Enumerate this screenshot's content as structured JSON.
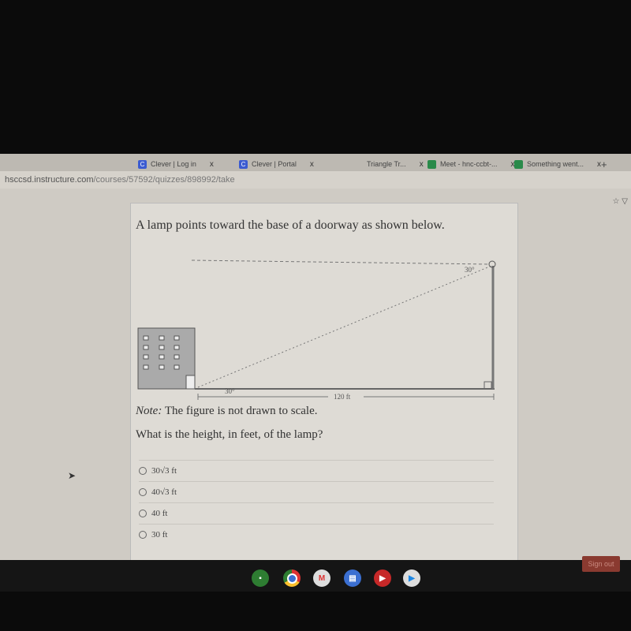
{
  "browser": {
    "tabs": [
      {
        "label": "Clever | Log in",
        "icon": "clever-icon"
      },
      {
        "label": "Clever | Portal",
        "icon": "clever-icon"
      },
      {
        "label": "Triangle Tr...",
        "icon": ""
      },
      {
        "label": "Meet - hnc-ccbt-...",
        "icon": "meet-icon"
      },
      {
        "label": "Something went...",
        "icon": "meet-icon"
      }
    ],
    "new_tab": "+",
    "close": "x",
    "url_host": "hsccsd.instructure.com",
    "url_path": "/courses/57592/quizzes/898992/take",
    "bookmark_icon": "☆"
  },
  "question": {
    "prompt": "A lamp points toward the base of a doorway as shown below.",
    "figure": {
      "angle_top": "30°",
      "angle_bottom": "30°",
      "distance": "120 ft"
    },
    "note_label": "Note:",
    "note": "The figure is not drawn to scale.",
    "ask": "What is the height, in feet, of the lamp?",
    "options": [
      "30√3 ft",
      "40√3 ft",
      "40 ft",
      "30 ft"
    ]
  },
  "shelf": {
    "apps": [
      "classroom",
      "chrome",
      "gmail",
      "docs",
      "youtube",
      "play-store"
    ],
    "sign_out": "Sign out"
  }
}
